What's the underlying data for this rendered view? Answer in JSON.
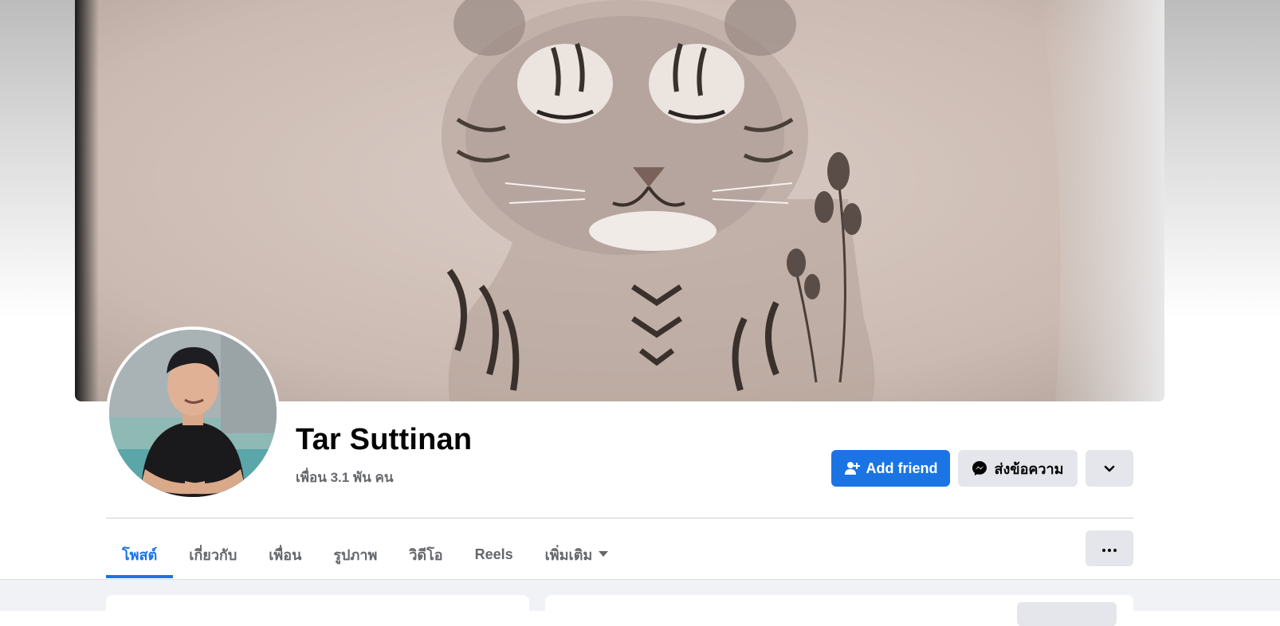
{
  "profile": {
    "name": "Tar Suttinan",
    "friends_text": "เพื่อน 3.1 พัน คน"
  },
  "actions": {
    "add_friend_label": "Add friend",
    "message_label": "ส่งข้อความ"
  },
  "tabs": [
    {
      "label": "โพสต์",
      "active": true
    },
    {
      "label": "เกี่ยวกับ"
    },
    {
      "label": "เพื่อน"
    },
    {
      "label": "รูปภาพ"
    },
    {
      "label": "วิดีโอ"
    },
    {
      "label": "Reels"
    },
    {
      "label": "เพิ่มเติม"
    }
  ],
  "colors": {
    "accent": "#1b74e4",
    "secondary_button": "#e4e6eb",
    "muted_text": "#65676b",
    "page_bg": "#f0f2f5"
  },
  "icons": {
    "add_friend": "person-plus-icon",
    "message": "messenger-icon",
    "chevron": "chevron-down-icon",
    "more_tab_caret": "caret-down-icon",
    "more_options": "ellipsis-icon"
  }
}
